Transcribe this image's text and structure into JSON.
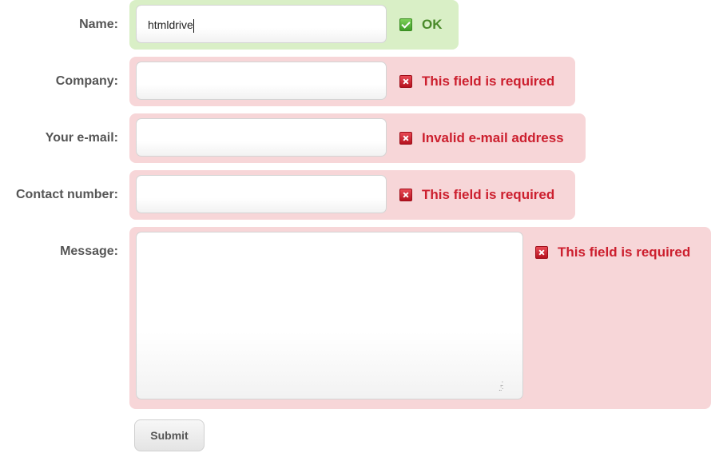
{
  "fields": {
    "name": {
      "label": "Name:",
      "value": "htmldrive",
      "status": "OK"
    },
    "company": {
      "label": "Company:",
      "value": "",
      "status": "This field is required"
    },
    "email": {
      "label": "Your e-mail:",
      "value": "",
      "status": "Invalid e-mail address"
    },
    "contact": {
      "label": "Contact number:",
      "value": "",
      "status": "This field is required"
    },
    "message": {
      "label": "Message:",
      "value": "",
      "status": "This field is required"
    }
  },
  "submit_label": "Submit",
  "colors": {
    "ok_bg": "#d9efc6",
    "ok_text": "#4a8a2a",
    "error_bg": "#f7d6d8",
    "error_text": "#cc1f2e"
  },
  "icons": {
    "ok": "check-icon",
    "error": "cross-icon"
  }
}
